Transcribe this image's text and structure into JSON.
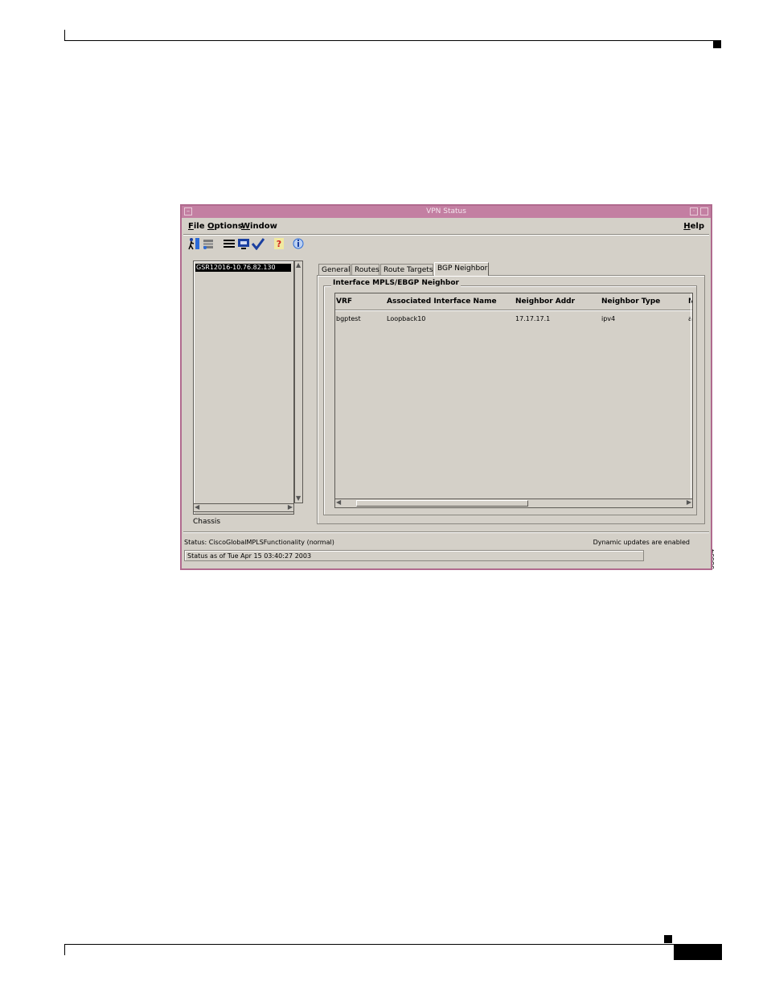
{
  "window": {
    "title": "VPN Status",
    "menu": [
      {
        "label": "File",
        "mnemonic": "F",
        "rest": "ile"
      },
      {
        "label": "Options",
        "mnemonic": "O",
        "rest": "ptions"
      },
      {
        "label": "Window",
        "mnemonic": "W",
        "rest": "indow"
      }
    ],
    "help_menu": {
      "label": "Help",
      "mnemonic": "H",
      "rest": "elp"
    },
    "toolbar_icons": [
      "run-icon",
      "stack-icon",
      "list-icon",
      "monitor-icon",
      "check-icon",
      "help-icon",
      "info-icon"
    ]
  },
  "tree": {
    "selected_item": "GSR12016-10.76.82.130",
    "label": "Chassis"
  },
  "tabs": [
    {
      "label": "General",
      "active": false
    },
    {
      "label": "Routes",
      "active": false
    },
    {
      "label": "Route Targets",
      "active": false
    },
    {
      "label": "BGP Neighbor",
      "active": true
    }
  ],
  "group": {
    "title": "Interface MPLS/EBGP Neighbor"
  },
  "table": {
    "columns": [
      "VRF",
      "Associated Interface Name",
      "Neighbor Addr",
      "Neighbor Type",
      "N"
    ],
    "rows": [
      [
        "bgptest",
        "Loopback10",
        "17.17.17.1",
        "ipv4",
        "a"
      ]
    ]
  },
  "status": {
    "functionality": "Status: CiscoGlobalMPLSFunctionality (normal)",
    "updates": "Dynamic updates are enabled",
    "timestamp": "Status as of Tue Apr 15 03:40:27 2003"
  },
  "figure_id": "93694"
}
